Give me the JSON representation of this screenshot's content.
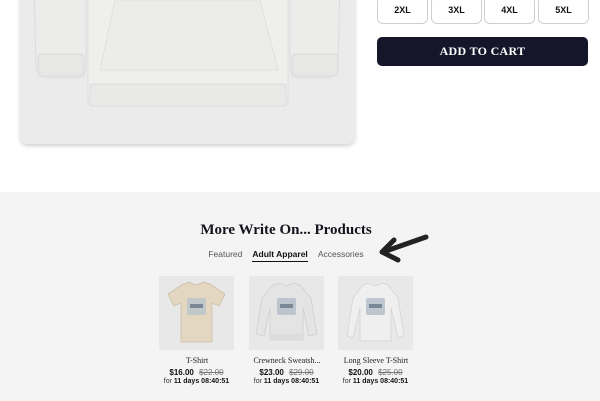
{
  "sizes": [
    "2XL",
    "3XL",
    "4XL",
    "5XL"
  ],
  "add_to_cart": "ADD TO CART",
  "more": {
    "title": "More Write On... Products",
    "tabs": [
      "Featured",
      "Adult Apparel",
      "Accessories"
    ],
    "active_tab": "Adult Apparel"
  },
  "products": [
    {
      "name": "T-Shirt",
      "price": "$16.00",
      "old_price": "$22.00",
      "timer_prefix": "for",
      "timer_days": "11 days",
      "timer_time": "08:40:51",
      "color": "#e3d7c1"
    },
    {
      "name": "Crewneck Sweatsh...",
      "price": "$23.00",
      "old_price": "$29.00",
      "timer_prefix": "for",
      "timer_days": "11 days",
      "timer_time": "08:40:51",
      "color": "#e4e4e4"
    },
    {
      "name": "Long Sleeve T-Shirt",
      "price": "$20.00",
      "old_price": "$25.00",
      "timer_prefix": "for",
      "timer_days": "11 days",
      "timer_time": "08:40:51",
      "color": "#efefef"
    }
  ]
}
